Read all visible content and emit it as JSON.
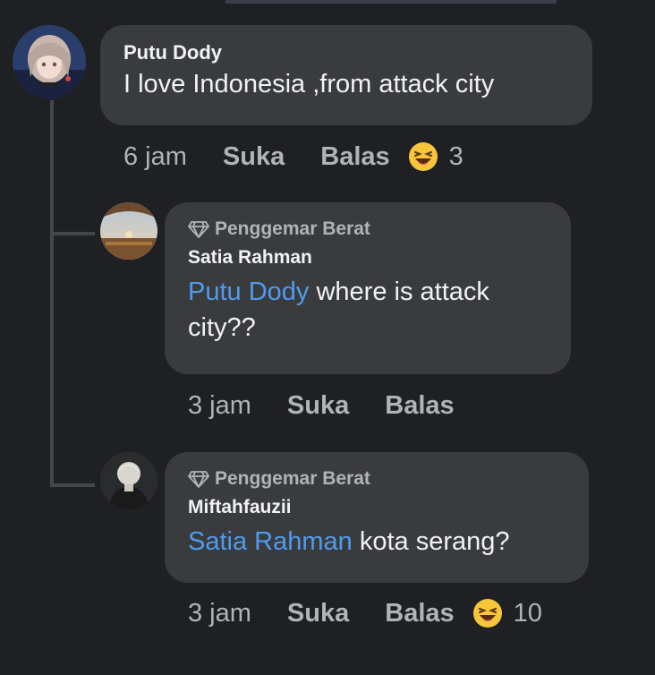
{
  "comments": [
    {
      "author": "Putu Dody",
      "text": "I love Indonesia ,from attack city",
      "time": "6 jam",
      "like_label": "Suka",
      "reply_label": "Balas",
      "reaction_icon": "laughing-emoji-icon",
      "reaction_count": "3"
    }
  ],
  "replies": [
    {
      "badge": "Penggemar Berat",
      "author": "Satia Rahman",
      "mention": "Putu Dody",
      "text": " where is attack city??",
      "time": "3 jam",
      "like_label": "Suka",
      "reply_label": "Balas"
    },
    {
      "badge": "Penggemar Berat",
      "author": "Miftahfauzii",
      "mention": "Satia Rahman",
      "text": " kota serang?",
      "time": "3 jam",
      "like_label": "Suka",
      "reply_label": "Balas",
      "reaction_icon": "laughing-emoji-icon",
      "reaction_count": "10"
    }
  ],
  "colors": {
    "background": "#1f2023",
    "bubble": "#3a3b3c",
    "mention": "#4e9bf0",
    "muted": "#b0b3b8"
  }
}
